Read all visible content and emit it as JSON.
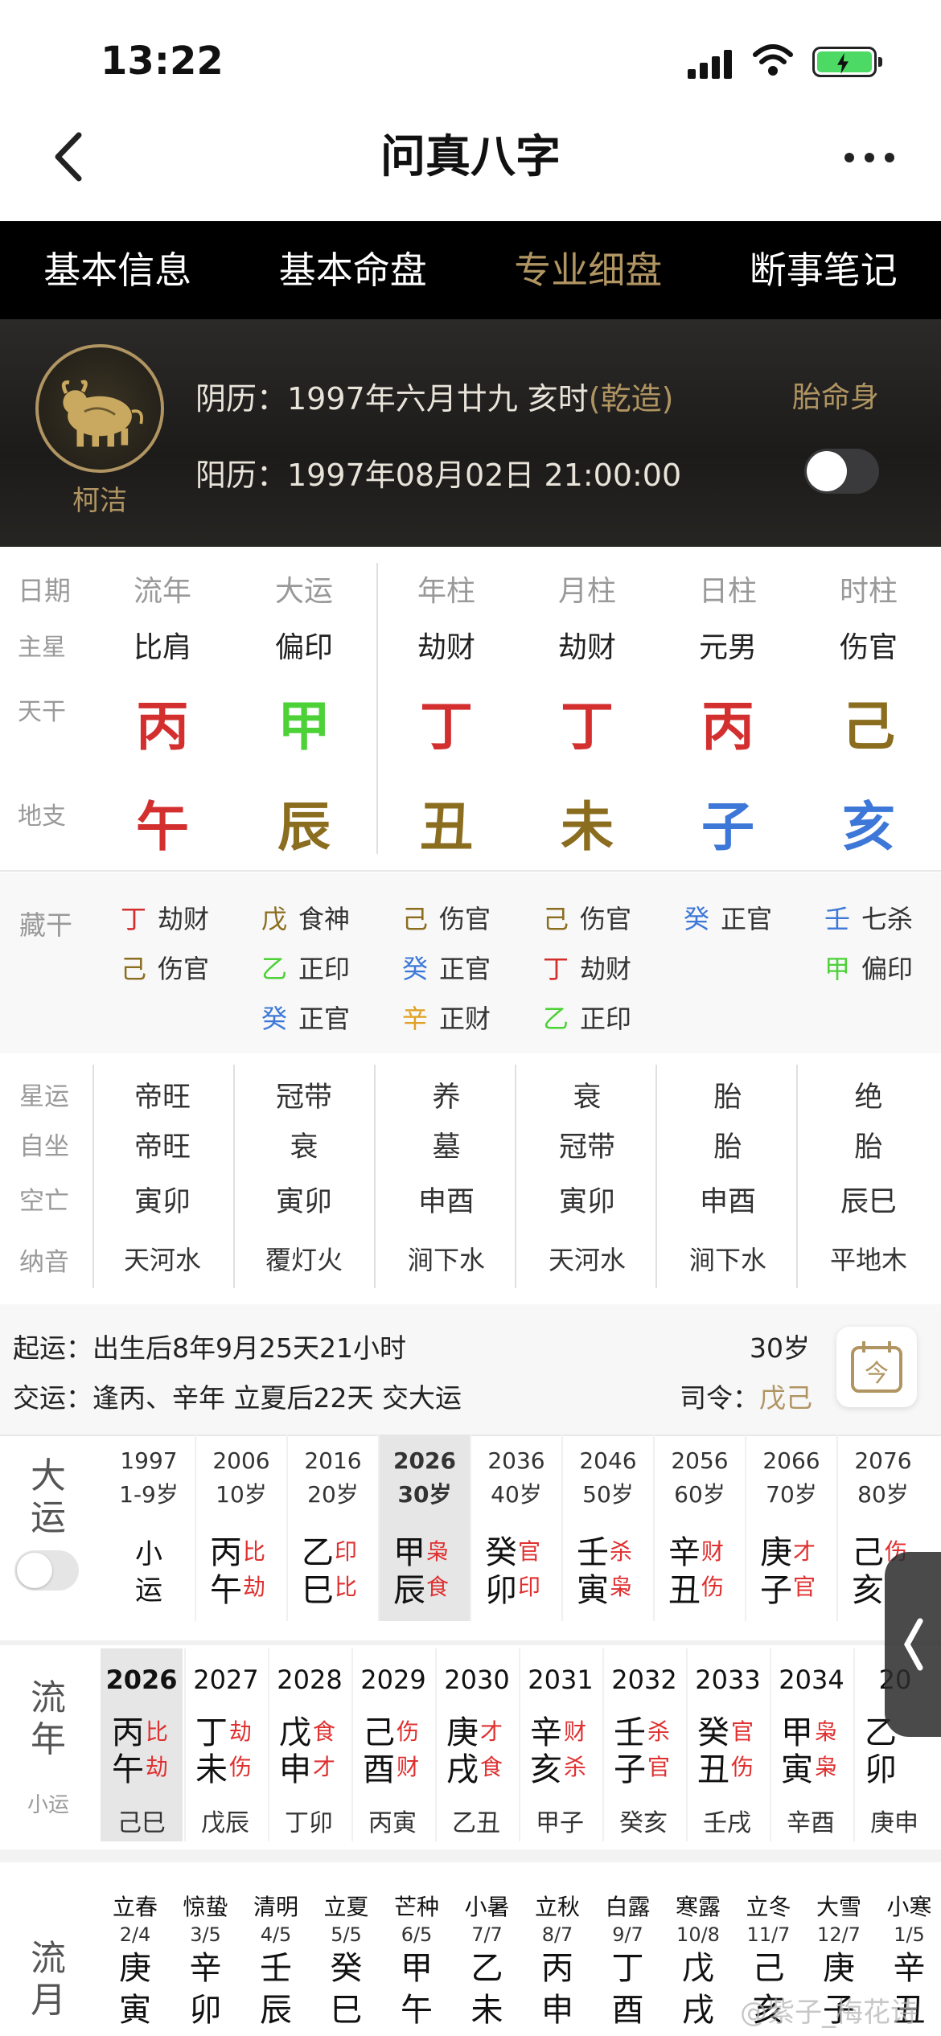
{
  "status": {
    "time": "13:22"
  },
  "nav": {
    "title": "问真八字"
  },
  "tabs": [
    "基本信息",
    "基本命盘",
    "专业细盘",
    "断事笔记"
  ],
  "profile": {
    "name": "柯洁",
    "lunar_prefix": "阴历：1997年六月廿九  亥时",
    "lunar_tag": "(乾造)",
    "solar": "阳历：1997年08月02日 21:00:00",
    "taimingshen": "胎命身"
  },
  "pillars": {
    "row_labels": [
      "日期",
      "主星",
      "天干",
      "地支"
    ],
    "headers": [
      "流年",
      "大运",
      "年柱",
      "月柱",
      "日柱",
      "时柱"
    ],
    "zhuxing": [
      "比肩",
      "偏印",
      "劫财",
      "劫财",
      "元男",
      "伤官"
    ],
    "tiangan": [
      "丙",
      "甲",
      "丁",
      "丁",
      "丙",
      "己"
    ],
    "dizhi": [
      "午",
      "辰",
      "丑",
      "未",
      "子",
      "亥"
    ]
  },
  "colors": {
    "fire": "#d32f2f",
    "wood": "#4cd137",
    "earth": "#8b6d1f",
    "water": "#3d78d8",
    "metal": "#e0a020",
    "gold": "#b09562"
  },
  "canggan": {
    "label": "藏干",
    "cols": [
      [
        [
          "丁",
          "劫财"
        ],
        [
          "己",
          "伤官"
        ]
      ],
      [
        [
          "戊",
          "食神"
        ],
        [
          "乙",
          "正印"
        ],
        [
          "癸",
          "正官"
        ]
      ],
      [
        [
          "己",
          "伤官"
        ],
        [
          "癸",
          "正官"
        ],
        [
          "辛",
          "正财"
        ]
      ],
      [
        [
          "己",
          "伤官"
        ],
        [
          "丁",
          "劫财"
        ],
        [
          "乙",
          "正印"
        ]
      ],
      [
        [
          "癸",
          "正官"
        ]
      ],
      [
        [
          "壬",
          "七杀"
        ],
        [
          "甲",
          "偏印"
        ]
      ]
    ]
  },
  "xingyun": {
    "labels": [
      "星运",
      "自坐",
      "空亡",
      "纳音"
    ],
    "rows": [
      [
        "帝旺",
        "冠带",
        "养",
        "衰",
        "胎",
        "绝"
      ],
      [
        "帝旺",
        "衰",
        "墓",
        "冠带",
        "胎",
        "胎"
      ],
      [
        "寅卯",
        "寅卯",
        "申酉",
        "寅卯",
        "申酉",
        "辰巳"
      ],
      [
        "天河水",
        "覆灯火",
        "涧下水",
        "天河水",
        "涧下水",
        "平地木"
      ]
    ]
  },
  "qiyun": {
    "line1": "起运：出生后8年9月25天21小时",
    "age": "30岁",
    "line2": "交运：逢丙、辛年 立夏后22天 交大运",
    "siling_label": "司令：",
    "siling_value": "戊己",
    "calendar_char": "今"
  },
  "dayun": {
    "label": "大运",
    "items": [
      {
        "year": "1997",
        "age": "1-9岁",
        "gan": "小",
        "zhi": "运",
        "s1": "",
        "s2": ""
      },
      {
        "year": "2006",
        "age": "10岁",
        "gan": "丙",
        "zhi": "午",
        "s1": "比",
        "s2": "劫"
      },
      {
        "year": "2016",
        "age": "20岁",
        "gan": "乙",
        "zhi": "巳",
        "s1": "印",
        "s2": "比"
      },
      {
        "year": "2026",
        "age": "30岁",
        "gan": "甲",
        "zhi": "辰",
        "s1": "枭",
        "s2": "食"
      },
      {
        "year": "2036",
        "age": "40岁",
        "gan": "癸",
        "zhi": "卯",
        "s1": "官",
        "s2": "印"
      },
      {
        "year": "2046",
        "age": "50岁",
        "gan": "壬",
        "zhi": "寅",
        "s1": "杀",
        "s2": "枭"
      },
      {
        "year": "2056",
        "age": "60岁",
        "gan": "辛",
        "zhi": "丑",
        "s1": "财",
        "s2": "伤"
      },
      {
        "year": "2066",
        "age": "70岁",
        "gan": "庚",
        "zhi": "子",
        "s1": "才",
        "s2": "官"
      },
      {
        "year": "2076",
        "age": "80岁",
        "gan": "己",
        "zhi": "亥",
        "s1": "伤",
        "s2": ""
      }
    ]
  },
  "liunian": {
    "label": "流年",
    "sublabel": "小运",
    "items": [
      {
        "year": "2026",
        "gan": "丙",
        "zhi": "午",
        "s1": "比",
        "s2": "劫",
        "xy": "己巳"
      },
      {
        "year": "2027",
        "gan": "丁",
        "zhi": "未",
        "s1": "劫",
        "s2": "伤",
        "xy": "戊辰"
      },
      {
        "year": "2028",
        "gan": "戊",
        "zhi": "申",
        "s1": "食",
        "s2": "才",
        "xy": "丁卯"
      },
      {
        "year": "2029",
        "gan": "己",
        "zhi": "酉",
        "s1": "伤",
        "s2": "财",
        "xy": "丙寅"
      },
      {
        "year": "2030",
        "gan": "庚",
        "zhi": "戌",
        "s1": "才",
        "s2": "食",
        "xy": "乙丑"
      },
      {
        "year": "2031",
        "gan": "辛",
        "zhi": "亥",
        "s1": "财",
        "s2": "杀",
        "xy": "甲子"
      },
      {
        "year": "2032",
        "gan": "壬",
        "zhi": "子",
        "s1": "杀",
        "s2": "官",
        "xy": "癸亥"
      },
      {
        "year": "2033",
        "gan": "癸",
        "zhi": "丑",
        "s1": "官",
        "s2": "伤",
        "xy": "壬戌"
      },
      {
        "year": "2034",
        "gan": "甲",
        "zhi": "寅",
        "s1": "枭",
        "s2": "枭",
        "xy": "辛酉"
      },
      {
        "year": "20",
        "gan": "乙",
        "zhi": "卯",
        "s1": "",
        "s2": "",
        "xy": "庚申"
      }
    ]
  },
  "liuyue": {
    "label": "流月",
    "items": [
      {
        "jq": "立春",
        "dt": "2/4",
        "g": "庚",
        "z": "寅"
      },
      {
        "jq": "惊蛰",
        "dt": "3/5",
        "g": "辛",
        "z": "卯"
      },
      {
        "jq": "清明",
        "dt": "4/5",
        "g": "壬",
        "z": "辰"
      },
      {
        "jq": "立夏",
        "dt": "5/5",
        "g": "癸",
        "z": "巳"
      },
      {
        "jq": "芒种",
        "dt": "6/5",
        "g": "甲",
        "z": "午"
      },
      {
        "jq": "小暑",
        "dt": "7/7",
        "g": "乙",
        "z": "未"
      },
      {
        "jq": "立秋",
        "dt": "8/7",
        "g": "丙",
        "z": "申"
      },
      {
        "jq": "白露",
        "dt": "9/7",
        "g": "丁",
        "z": "酉"
      },
      {
        "jq": "寒露",
        "dt": "10/8",
        "g": "戊",
        "z": "戌"
      },
      {
        "jq": "立冬",
        "dt": "11/7",
        "g": "己",
        "z": "亥"
      },
      {
        "jq": "大雪",
        "dt": "12/7",
        "g": "庚",
        "z": "子"
      },
      {
        "jq": "小寒",
        "dt": "1/5",
        "g": "辛",
        "z": "丑"
      }
    ]
  },
  "watermark": "@紫子_梅花诗"
}
